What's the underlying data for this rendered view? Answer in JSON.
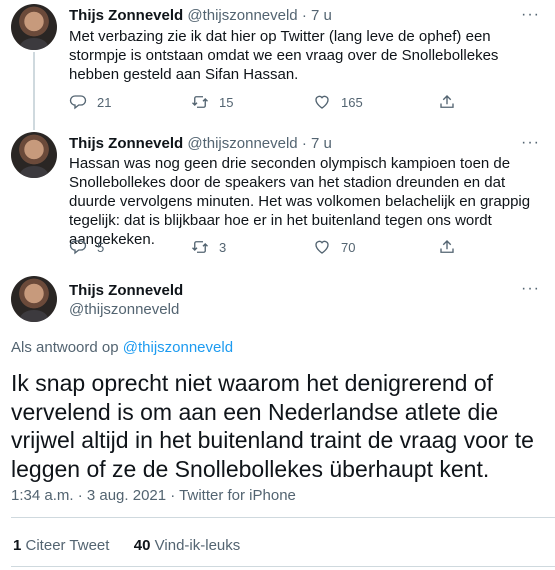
{
  "tweets": [
    {
      "name": "Thijs Zonneveld",
      "handle": "@thijszonneveld",
      "time": "· 7 u",
      "text": "Met verbazing zie ik dat hier op Twitter (lang leve de ophef) een stormpje is ontstaan omdat we een vraag over de Snollebollekes hebben gesteld aan Sifan Hassan.",
      "replies": "21",
      "retweets": "15",
      "likes": "165"
    },
    {
      "name": "Thijs Zonneveld",
      "handle": "@thijszonneveld",
      "time": "· 7 u",
      "text": "Hassan was nog geen drie seconden olympisch kampioen toen de Snollebollekes door de speakers van het stadion dreunden en dat duurde vervolgens minuten. Het was volkomen belachelijk en grappig tegelijk: dat is blijkbaar hoe er in het buitenland tegen ons wordt aangekeken.",
      "replies": "5",
      "retweets": "3",
      "likes": "70"
    }
  ],
  "main_tweet": {
    "name": "Thijs Zonneveld",
    "handle": "@thijszonneveld",
    "reply_prefix": "Als antwoord op",
    "reply_handle": "@thijszonneveld",
    "text": "Ik snap oprecht niet waarom het denigrerend of vervelend is om aan een Nederlandse atlete die vrijwel altijd in het buitenland traint de vraag voor te leggen of ze de Snollebollekes überhaupt kent.",
    "timestamp": "1:34 a.m. · 3 aug. 2021 · Twitter for iPhone",
    "quote_count": "1",
    "quote_label": "Citeer Tweet",
    "like_count": "40",
    "like_label": "Vind-ik-leuks"
  },
  "icons": {
    "reply": "reply-icon",
    "retweet": "retweet-icon",
    "like": "heart-icon",
    "share": "share-icon",
    "more": "more-icon"
  },
  "colors": {
    "text": "#0f1419",
    "secondary": "#536471",
    "link": "#1d9bf0",
    "divider": "#cfd9de"
  }
}
